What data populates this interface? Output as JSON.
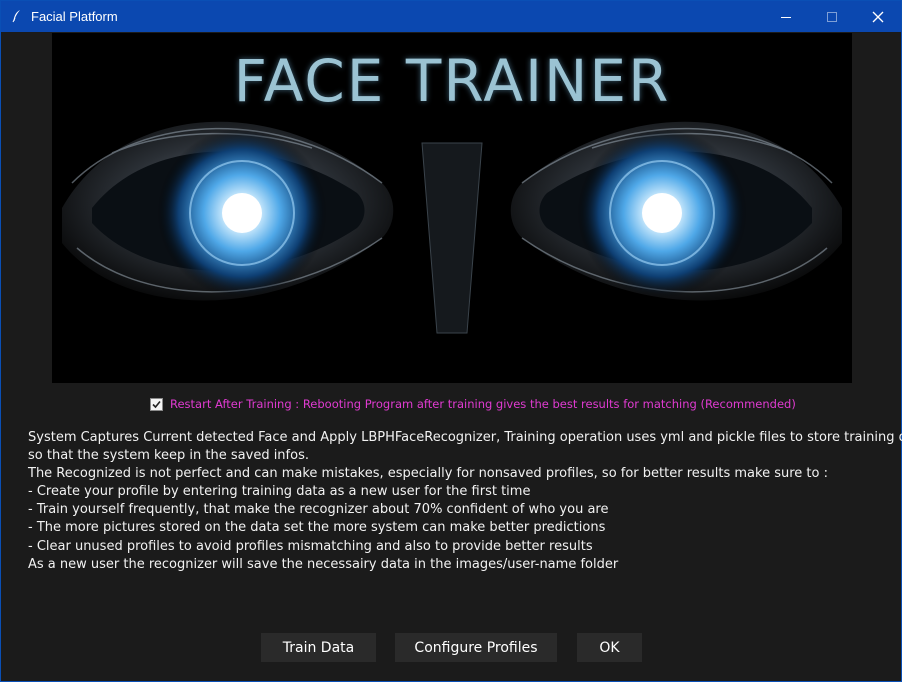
{
  "window": {
    "title": "Facial Platform",
    "accent": "#0b48b0"
  },
  "banner": {
    "title": "FACE TRAINER"
  },
  "restart_option": {
    "checked": true,
    "label": "Restart After Training : Rebooting Program after training gives the best results for matching (Recommended)",
    "color": "#e03bd1"
  },
  "description": {
    "lines": [
      "System Captures Current detected Face and Apply LBPHFaceRecognizer, Training operation uses yml and pickle files to store training data",
      "so that the system keep in the saved infos.",
      "The Recognized is not perfect and can make mistakes, especially for nonsaved profiles, so for better results make sure to :",
      "- Create your profile by entering training data as a new user for the first time",
      "- Train yourself frequently, that make the recognizer about 70% confident of who you are",
      "- The more pictures stored on the data set the more system can make better predictions",
      "- Clear unused profiles to avoid profiles mismatching and also to provide better results",
      "As a new user the recognizer will save the necessairy data in the images/user-name folder"
    ]
  },
  "buttons": {
    "train": "Train Data",
    "configure": "Configure Profiles",
    "ok": "OK"
  }
}
